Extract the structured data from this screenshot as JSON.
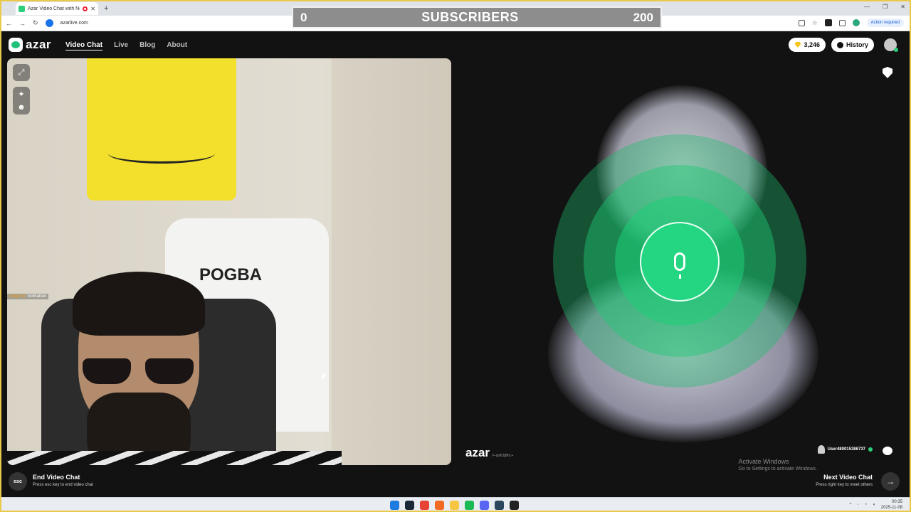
{
  "browser": {
    "tab_title": "Azar Video Chat with New",
    "tab_close": "✕",
    "new_tab": "+",
    "url": "azarlive.com",
    "action_required": "Action required",
    "window_controls": [
      "—",
      "❐",
      "✕"
    ]
  },
  "overlay": {
    "min": "0",
    "label": "SUBSCRIBERS",
    "max": "200",
    "progress": 0
  },
  "header": {
    "logo_text": "azar",
    "nav": [
      "Video Chat",
      "Live",
      "Blog",
      "About"
    ],
    "active_nav": "Video Chat",
    "gems": "3,246",
    "history_label": "History"
  },
  "left_video": {
    "jersey_name": "POGBA",
    "chat_user": "tydigntel",
    "chat_text": ": trollhatten"
  },
  "right_video": {
    "watermark": "azar",
    "watermark_code": "F-qoK3jBhL+",
    "username": "User480015386737",
    "mic_icon": "microphone-icon"
  },
  "footer": {
    "esc_label": "esc",
    "end_title": "End Video Chat",
    "end_sub": "Press esc key to end video chat",
    "next_title": "Next Video Chat",
    "next_sub": "Press right key to meet others",
    "activate_title": "Activate Windows",
    "activate_sub": "Go to Settings to activate Windows."
  },
  "taskbar": {
    "time": "00:35",
    "date": "2025-11-08"
  },
  "colors": {
    "accent_green": "#24d682",
    "overlay_gray": "#8d8d8d",
    "background": "#121212"
  }
}
